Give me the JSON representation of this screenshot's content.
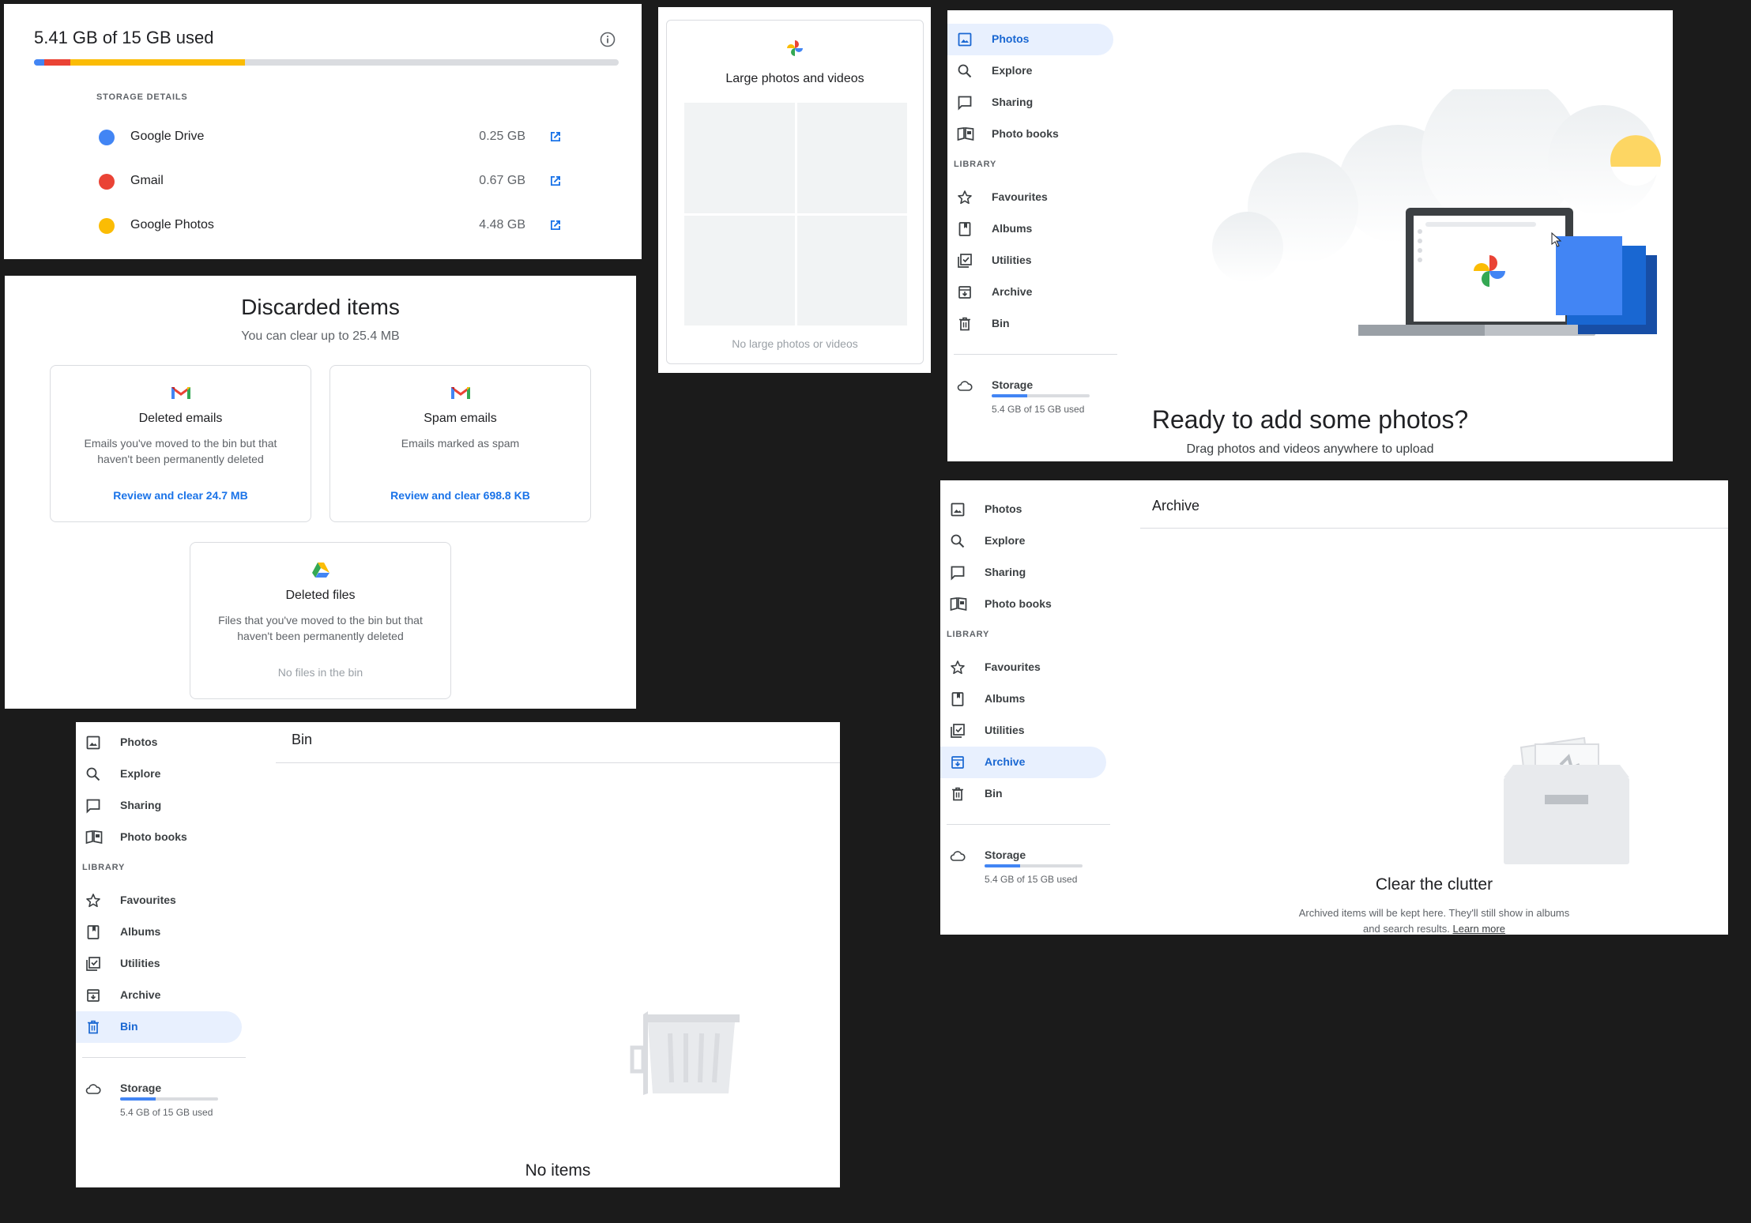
{
  "storage": {
    "title": "5.41 GB of 15 GB used",
    "details_heading": "STORAGE DETAILS",
    "bar": [
      {
        "color": "#4285f4",
        "fraction": 0.017
      },
      {
        "color": "#ea4335",
        "fraction": 0.045
      },
      {
        "color": "#fbbc04",
        "fraction": 0.299
      }
    ],
    "items": [
      {
        "name": "Google Drive",
        "size": "0.25 GB",
        "color": "#4285f4"
      },
      {
        "name": "Gmail",
        "size": "0.67 GB",
        "color": "#ea4335"
      },
      {
        "name": "Google Photos",
        "size": "4.48 GB",
        "color": "#fbbc04"
      }
    ]
  },
  "discarded": {
    "title": "Discarded items",
    "subtitle": "You can clear up to 25.4 MB",
    "cards": [
      {
        "title": "Deleted emails",
        "desc": "Emails you've moved to the bin but that haven't been permanently deleted",
        "action": "Review and clear 24.7 MB"
      },
      {
        "title": "Spam emails",
        "desc": "Emails marked as spam",
        "action": "Review and clear 698.8 KB"
      },
      {
        "title": "Deleted files",
        "desc": "Files that you've moved to the bin but that haven't been permanently deleted",
        "status": "No files in the bin"
      }
    ]
  },
  "large": {
    "title": "Large photos and videos",
    "empty": "No large photos or videos"
  },
  "nav": {
    "photos": "Photos",
    "explore": "Explore",
    "sharing": "Sharing",
    "photo_books": "Photo books",
    "library": "LIBRARY",
    "favourites": "Favourites",
    "albums": "Albums",
    "utilities": "Utilities",
    "archive": "Archive",
    "bin": "Bin",
    "storage": "Storage",
    "storage_used": "5.4 GB of 15 GB used",
    "storage_fraction": 0.36
  },
  "photos_view": {
    "heading": "Ready to add some photos?",
    "sub": "Drag photos and videos anywhere to upload"
  },
  "archive_view": {
    "title": "Archive",
    "heading": "Clear the clutter",
    "desc": "Archived items will be kept here. They'll still show in albums and search results.",
    "link": "Learn more"
  },
  "bin_view": {
    "title": "Bin",
    "heading": "No items"
  }
}
